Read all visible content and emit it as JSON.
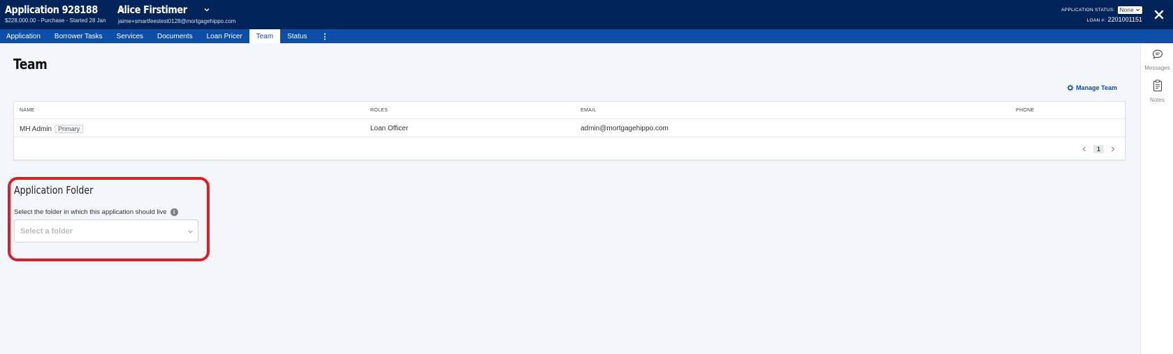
{
  "header": {
    "app_title": "Application 928188",
    "app_sub": "$228,000.00 - Purchase - Started 28 Jan",
    "borrower_name": "Alice Firstimer",
    "borrower_email": "jaime+smartfeestest0128@mortgagehippo.com",
    "status_label": "APPLICATION STATUS:",
    "status_value": "None",
    "loan_label": "LOAN #:",
    "loan_number": "2201001151"
  },
  "nav": {
    "tabs": [
      {
        "label": "Application"
      },
      {
        "label": "Borrower Tasks"
      },
      {
        "label": "Services"
      },
      {
        "label": "Documents"
      },
      {
        "label": "Loan Pricer"
      },
      {
        "label": "Team"
      },
      {
        "label": "Status"
      }
    ],
    "active": "Team",
    "more_label": "⋮"
  },
  "rail": {
    "messages_label": "Messages",
    "notes_label": "Notes"
  },
  "team": {
    "title": "Team",
    "manage_label": "Manage Team",
    "columns": [
      "NAME",
      "ROLES",
      "EMAIL",
      "PHONE"
    ],
    "rows": [
      {
        "name": "MH Admin",
        "badge": "Primary",
        "role": "Loan Officer",
        "email": "admin@mortgagehippo.com",
        "phone": ""
      }
    ],
    "page": "1"
  },
  "folder": {
    "title": "Application Folder",
    "label": "Select the folder in which this application should live",
    "info_glyph": "i",
    "placeholder": "Select a folder"
  },
  "colors": {
    "header_bg": "#00245a",
    "nav_bg": "#0d4ea6",
    "highlight": "#e31b23",
    "page_bg": "#f3f6fb"
  }
}
